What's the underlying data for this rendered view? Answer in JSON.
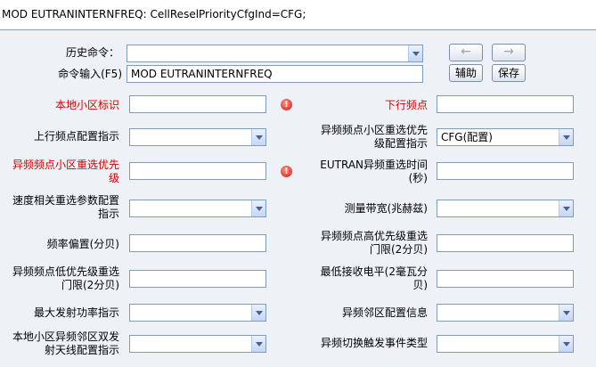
{
  "command_line": "MOD EUTRANINTERNFREQ: CellReselPriorityCfgInd=CFG;",
  "history": {
    "label": "历史命令：",
    "value": ""
  },
  "command_input": {
    "label": "命令输入(F5)",
    "value": "MOD EUTRANINTERNFREQ"
  },
  "nav": {
    "prev": "←",
    "next": "→"
  },
  "buttons": {
    "help": "辅助",
    "save": "保存"
  },
  "warn_icon": "!",
  "params": {
    "local_cell_id": {
      "label": "本地小区标识",
      "value": ""
    },
    "dl_earfcn": {
      "label": "下行频点",
      "value": ""
    },
    "ul_earfcn_cfg_ind": {
      "label": "上行频点配置指示",
      "value": ""
    },
    "resel_priority_cfg_ind": {
      "label": "异频频点小区重选优先级配置指示",
      "value": "CFG(配置)"
    },
    "resel_priority": {
      "label": "异频频点小区重选优先级",
      "value": ""
    },
    "eutran_resel_time": {
      "label": "EUTRAN异频重选时间(秒)",
      "value": ""
    },
    "speed_resel_cfg_ind": {
      "label": "速度相关重选参数配置指示",
      "value": ""
    },
    "meas_bandwidth": {
      "label": "测量带宽(兆赫兹)",
      "value": ""
    },
    "q_offset_freq": {
      "label": "频率偏置(分贝)",
      "value": ""
    },
    "thresh_x_high": {
      "label": "异频频点高优先级重选门限(2分贝)",
      "value": ""
    },
    "thresh_x_low": {
      "label": "异频频点低优先级重选门限(2分贝)",
      "value": ""
    },
    "q_rx_lev_min": {
      "label": "最低接收电平(2毫瓦分贝)",
      "value": ""
    },
    "p_max_cfg_ind": {
      "label": "最大发射功率指示",
      "value": ""
    },
    "neigh_cell_cfg": {
      "label": "异频邻区配置信息",
      "value": ""
    },
    "dual_tx_ant_cfg_ind": {
      "label": "本地小区异频邻区双发射天线配置指示",
      "value": ""
    },
    "ho_event_type": {
      "label": "异频切换触发事件类型",
      "value": ""
    }
  }
}
